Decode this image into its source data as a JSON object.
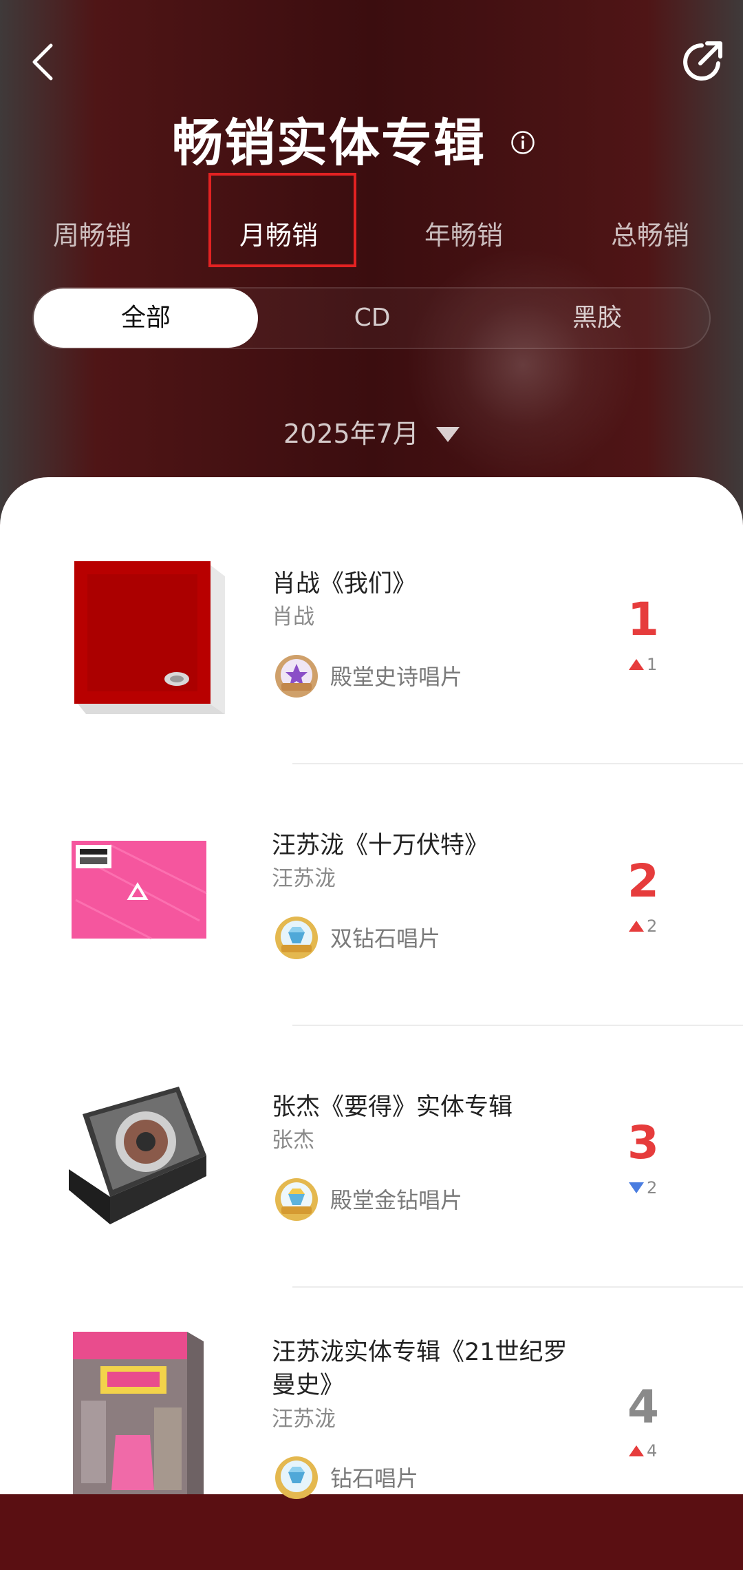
{
  "header": {
    "title": "畅销实体专辑",
    "period_tabs": [
      "周畅销",
      "月畅销",
      "年畅销",
      "总畅销"
    ],
    "active_period": "月畅销",
    "format_tabs": [
      "全部",
      "CD",
      "黑胶"
    ],
    "active_format": "全部",
    "month": "2025年7月"
  },
  "colors": {
    "accent": "#e63c3c",
    "rank_grey": "#8a8a8a",
    "trend_up": "#e63c3c",
    "trend_down": "#4a7de0",
    "highlight_box": "#e32222"
  },
  "icons": [
    "back-icon",
    "share-icon",
    "info-icon",
    "dropdown-arrow-icon",
    "badge-medal-icon",
    "trend-up-icon",
    "trend-down-icon"
  ],
  "items": [
    {
      "title": "肖战《我们》",
      "artist": "肖战",
      "badge": "殿堂史诗唱片",
      "rank": "1",
      "trend_direction": "up",
      "trend_value": "1"
    },
    {
      "title": "汪苏泷《十万伏特》",
      "artist": "汪苏泷",
      "badge": "双钻石唱片",
      "rank": "2",
      "trend_direction": "up",
      "trend_value": "2"
    },
    {
      "title": "张杰《要得》实体专辑",
      "artist": "张杰",
      "badge": "殿堂金钻唱片",
      "rank": "3",
      "trend_direction": "down",
      "trend_value": "2"
    },
    {
      "title": "汪苏泷实体专辑《21世纪罗曼史》",
      "artist": "汪苏泷",
      "badge": "钻石唱片",
      "rank": "4",
      "trend_direction": "up",
      "trend_value": "4"
    }
  ]
}
